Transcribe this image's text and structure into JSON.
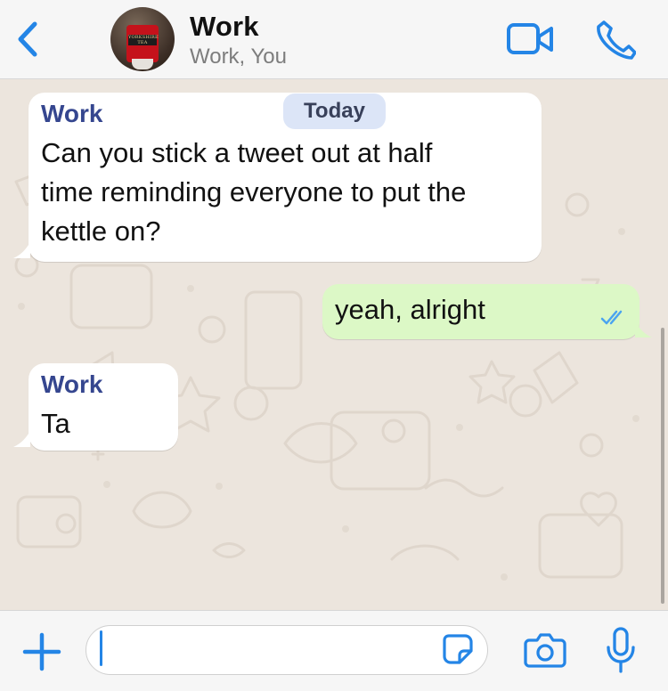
{
  "header": {
    "back_icon": "chevron-left-icon",
    "avatar": "group-avatar-yorkshire-tea",
    "avatar_text": "YORKSHIRE TEA",
    "title": "Work",
    "subtitle": "Work, You",
    "video_icon": "video-call-icon",
    "call_icon": "phone-icon"
  },
  "chat": {
    "date_label": "Today",
    "messages": [
      {
        "direction": "incoming",
        "sender": "Work",
        "lines": [
          "Can you stick a tweet out at half",
          "time reminding everyone to put the",
          "kettle on?"
        ]
      },
      {
        "direction": "outgoing",
        "text": "yeah, alright",
        "status_icon": "double-check-read-icon"
      },
      {
        "direction": "incoming",
        "sender": "Work",
        "text": "Ta"
      }
    ]
  },
  "composer": {
    "plus_icon": "plus-icon",
    "input_value": "",
    "sticker_icon": "sticker-icon",
    "camera_icon": "camera-icon",
    "mic_icon": "microphone-icon"
  },
  "colors": {
    "accent": "#2485e6",
    "sender_name": "#35468f",
    "outgoing_bubble": "#dcf8c6",
    "incoming_bubble": "#ffffff",
    "chat_background": "#ece5dd",
    "date_chip": "#dce5f7"
  }
}
